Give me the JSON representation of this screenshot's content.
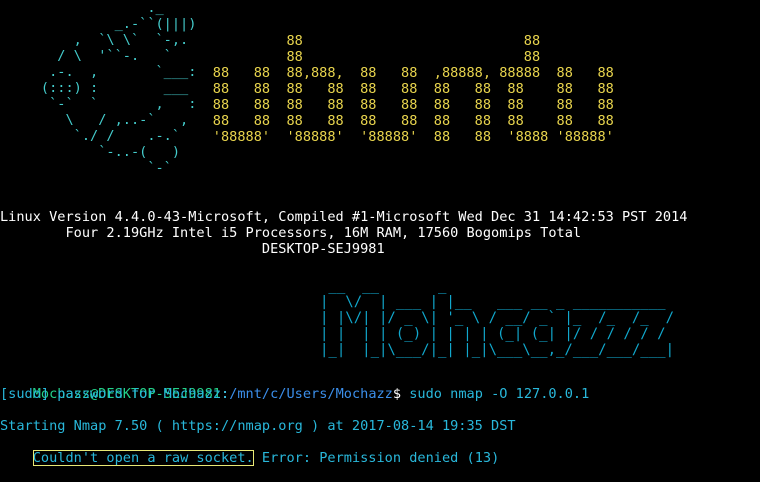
{
  "window": {
    "background": "#000000"
  },
  "logo": {
    "lines": [
      "                  ._",
      "              _.-``(|||)",
      "         ,  `\\ \\`  `-,.",
      "       / \\  '``-.   `",
      "      .-.  ,       `___:",
      "     (:::) :        ___",
      "      `-`  `       ,   :",
      "        \\   / ,..-`   ,",
      "         `./ /    .-.`",
      "            `-..-(   )",
      "                  `-`"
    ]
  },
  "banner": {
    "lines": [
      "                                   88                           88",
      "                                   88                           88",
      "                          88   88  88,888,  88   88  ,88888, 88888  88   88",
      "                          88   88  88   88  88   88  88   88  88    88   88",
      "                          88   88  88   88  88   88  88   88  88    88   88",
      "                          88   88  88   88  88   88  88   88  88    88   88",
      "                          '88888'  '88888'  '88888'  88   88  '8888 '88888'"
    ]
  },
  "sysinfo": {
    "line1": "Linux Version 4.4.0-43-Microsoft, Compiled #1-Microsoft Wed Dec 31 14:42:53 PST 2014",
    "line2": "        Four 2.19GHz Intel i5 Processors, 16M RAM, 17560 Bogomips Total",
    "line3": "                                DESKTOP-SEJ9981"
  },
  "ascii_art": {
    "label": "Mohcazz",
    "lines": [
      " __  __       _",
      "|  \\/  | ___ | |__   ___ __ _ ___________",
      "| |\\/| |/ _ \\| '_ \\ / __/ _` |_  /_  /_  /",
      "| |  | | (_) | | | | (_| (_| |/ / / / / /",
      "|_|  |_|\\___/|_| |_|\\___\\__,_/___/___/___|"
    ]
  },
  "prompt": {
    "user_host": "Mochazz@DESKTOP-SEJ9981",
    "sep": ":",
    "path": "/mnt/c/Users/Mochazz",
    "symbol": "$",
    "command": " sudo nmap -O 127.0.0.1"
  },
  "output": {
    "sudo": "[sudo] password for Mochazz:",
    "nmap_start": "Starting Nmap 7.50 ( https://nmap.org ) at 2017-08-14 19:35 DST",
    "error_highlight": "Couldn't open a raw socket.",
    "error_rest": " Error: Permission denied (13)"
  }
}
